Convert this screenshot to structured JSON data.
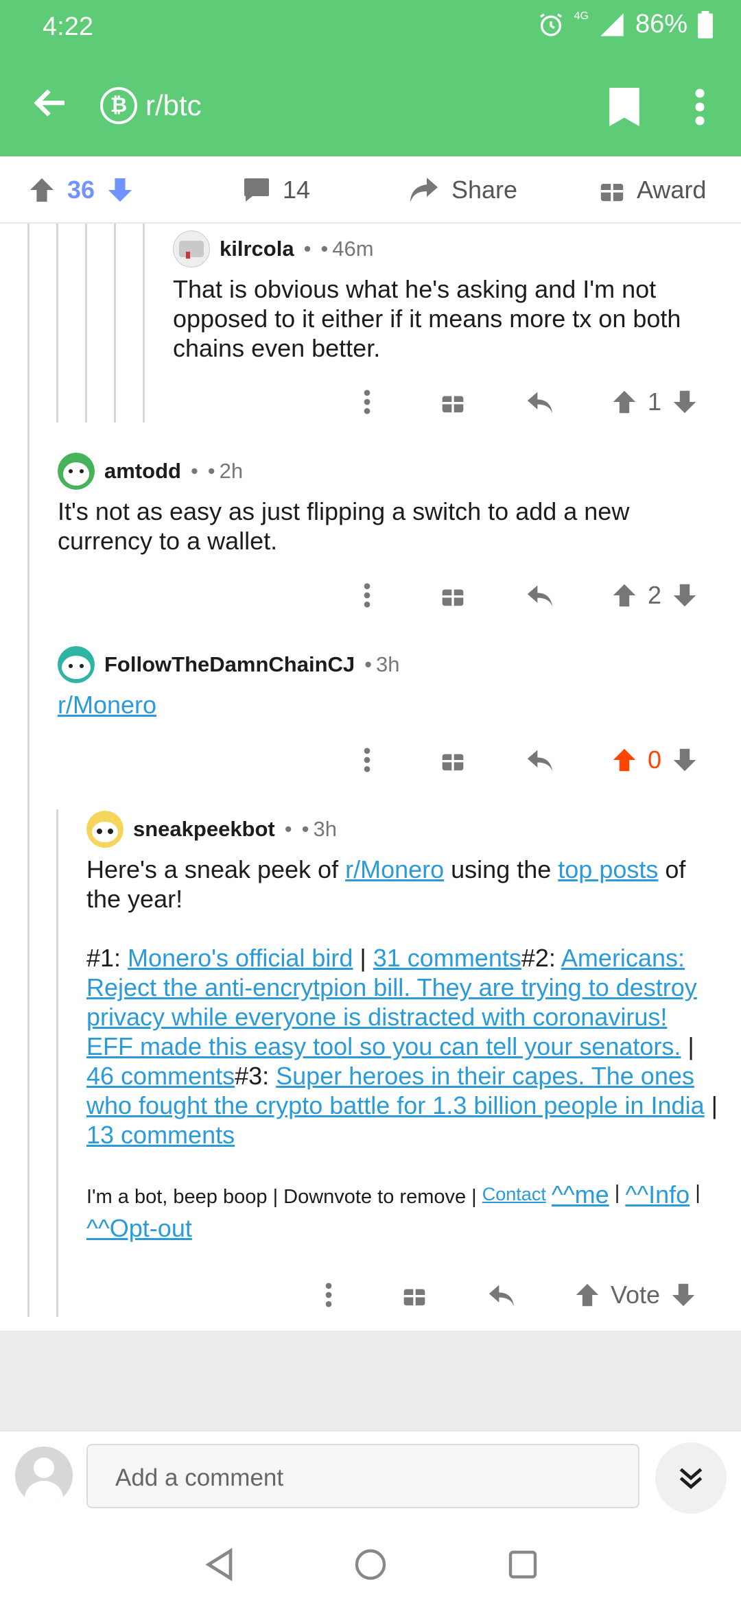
{
  "status": {
    "time": "4:22",
    "network": "4G",
    "battery": "86%"
  },
  "appbar": {
    "subreddit": "r/btc",
    "sub_icon_glyph": "₿",
    "icons": [
      "back-arrow-icon",
      "bitcoin-icon",
      "bookmark-icon",
      "more-vertical-icon"
    ]
  },
  "actionbar": {
    "score": "36",
    "comments": "14",
    "share": "Share",
    "award": "Award"
  },
  "comments": [
    {
      "author": "kilrcola",
      "sep": "•",
      "flair": "•",
      "time": "46m",
      "body": "That is obvious what he's asking and I'm not opposed to it either if it means more tx on both chains even better.",
      "score": "1"
    },
    {
      "author": "amtodd",
      "sep": "•",
      "flair": "•",
      "time": "2h",
      "body": "It's not as easy as just flipping a switch to add a new currency to a wallet.",
      "score": "2"
    },
    {
      "author": "FollowTheDamnChainCJ",
      "sep": "•",
      "time": "3h",
      "link": "r/Monero",
      "score": "0"
    },
    {
      "author": "sneakpeekbot",
      "sep": "•",
      "flair": "•",
      "time": "3h",
      "intro_1": "Here's a sneak peek of ",
      "intro_link1": "r/Monero",
      "intro_2": " using the ",
      "intro_link2": "top posts",
      "intro_3": " of the year!",
      "n1": "#1: ",
      "p1": "Monero's official bird",
      "pipe": " | ",
      "c1": "31 comments",
      "n2": "#2: ",
      "p2": "Americans: Reject the anti-encrytpion bill. They are trying to destroy privacy while everyone is distracted with coronavirus! EFF made this easy tool so you can tell your senators.",
      "c2": "46 comments",
      "n3": "#3: ",
      "p3": "Super heroes in their capes. The ones who fought the crypto battle for 1.3 billion people in India",
      "c3": "13 comments",
      "footer_text": "I'm a bot, beep boop | Downvote to remove | ",
      "contact": "Contact",
      "me": "^^me",
      "bar": " | ",
      "info": "^^Info",
      "optout": "^^Opt-out",
      "score": "Vote"
    }
  ],
  "composer": {
    "placeholder": "Add a comment"
  },
  "colors": {
    "brand": "#5ecb77",
    "upvote_active": "#ff4500",
    "downvote_active": "#7193ff",
    "link": "#2a9bd8"
  }
}
